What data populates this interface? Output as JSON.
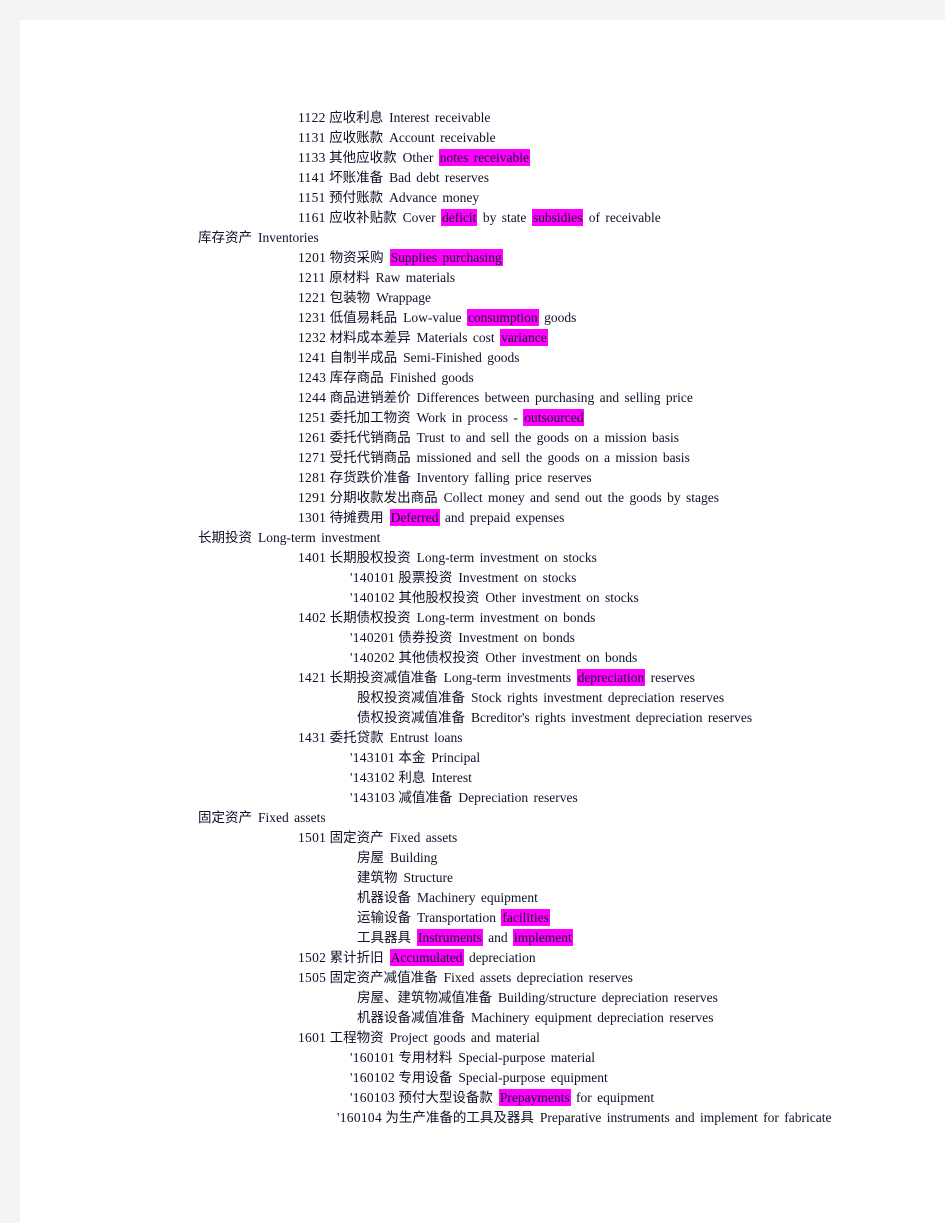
{
  "document": {
    "title": "Chinese-English Accounting Subjects (Assets)",
    "highlight_color": "#ff00ff",
    "text_color": "#101028",
    "page_background": "#ffffff",
    "canvas_background": "#f4f4f4"
  },
  "lines": [
    {
      "indent": "code",
      "code": "1122",
      "cn": "应收利息",
      "en": [
        {
          "t": "Interest receivable",
          "hl": false
        }
      ]
    },
    {
      "indent": "code",
      "code": "1131",
      "cn": "应收账款",
      "en": [
        {
          "t": "Account receivable",
          "hl": false
        }
      ]
    },
    {
      "indent": "code",
      "code": "1133",
      "cn": "其他应收款",
      "en": [
        {
          "t": "Other ",
          "hl": false
        },
        {
          "t": "notes receivable",
          "hl": true
        }
      ]
    },
    {
      "indent": "code",
      "code": "1141",
      "cn": "坏账准备",
      "en": [
        {
          "t": "Bad debt reserves",
          "hl": false
        }
      ]
    },
    {
      "indent": "code",
      "code": "1151",
      "cn": "预付账款",
      "en": [
        {
          "t": "Advance money",
          "hl": false
        }
      ]
    },
    {
      "indent": "code",
      "code": "1161",
      "cn": "应收补贴款",
      "en": [
        {
          "t": "Cover ",
          "hl": false
        },
        {
          "t": "deficit",
          "hl": true
        },
        {
          "t": " by state ",
          "hl": false
        },
        {
          "t": "subsidies",
          "hl": true
        },
        {
          "t": " of receivable",
          "hl": false
        }
      ]
    },
    {
      "indent": "head",
      "code": "",
      "cn": "库存资产",
      "en": [
        {
          "t": "Inventories",
          "hl": false
        }
      ]
    },
    {
      "indent": "code",
      "code": "1201",
      "cn": "物资采购",
      "en": [
        {
          "t": "Supplies purchasing",
          "hl": true
        }
      ]
    },
    {
      "indent": "code",
      "code": "1211",
      "cn": "原材料",
      "en": [
        {
          "t": "Raw materials",
          "hl": false
        }
      ]
    },
    {
      "indent": "code",
      "code": "1221",
      "cn": "包装物",
      "en": [
        {
          "t": "Wrappage",
          "hl": false
        }
      ]
    },
    {
      "indent": "code",
      "code": "1231",
      "cn": "低值易耗品",
      "en": [
        {
          "t": "Low-value ",
          "hl": false
        },
        {
          "t": "consumption",
          "hl": true
        },
        {
          "t": " goods",
          "hl": false
        }
      ]
    },
    {
      "indent": "code",
      "code": "1232",
      "cn": "材料成本差异",
      "en": [
        {
          "t": "Materials cost ",
          "hl": false
        },
        {
          "t": "variance",
          "hl": true
        }
      ]
    },
    {
      "indent": "code",
      "code": "1241",
      "cn": "自制半成品",
      "en": [
        {
          "t": "Semi-Finished goods",
          "hl": false
        }
      ]
    },
    {
      "indent": "code",
      "code": "1243",
      "cn": "库存商品",
      "en": [
        {
          "t": "Finished goods",
          "hl": false
        }
      ]
    },
    {
      "indent": "code",
      "code": "1244",
      "cn": "商品进销差价",
      "en": [
        {
          "t": "Differences between purchasing and selling price",
          "hl": false
        }
      ]
    },
    {
      "indent": "code",
      "code": "1251",
      "cn": "委托加工物资",
      "en": [
        {
          "t": "Work in process - ",
          "hl": false
        },
        {
          "t": "outsourced",
          "hl": true
        }
      ]
    },
    {
      "indent": "code",
      "code": "1261",
      "cn": "委托代销商品",
      "en": [
        {
          "t": "Trust to and sell the goods on a mission basis",
          "hl": false
        }
      ]
    },
    {
      "indent": "code",
      "code": "1271",
      "cn": "受托代销商品",
      "en": [
        {
          "t": "missioned and sell the goods on a mission basis",
          "hl": false
        }
      ]
    },
    {
      "indent": "code",
      "code": "1281",
      "cn": "存货跌价准备",
      "en": [
        {
          "t": "Inventory falling price reserves",
          "hl": false
        }
      ]
    },
    {
      "indent": "code",
      "code": "1291",
      "cn": "分期收款发出商品",
      "en": [
        {
          "t": "Collect money and send out the goods by stages",
          "hl": false
        }
      ]
    },
    {
      "indent": "code",
      "code": "1301",
      "cn": "待摊费用",
      "en": [
        {
          "t": "Deferred",
          "hl": true
        },
        {
          "t": " and prepaid expenses",
          "hl": false
        }
      ]
    },
    {
      "indent": "head",
      "code": "",
      "cn": "长期投资",
      "en": [
        {
          "t": "Long-term investment",
          "hl": false
        }
      ]
    },
    {
      "indent": "code",
      "code": "1401",
      "cn": "长期股权投资",
      "en": [
        {
          "t": "Long-term investment on stocks",
          "hl": false
        }
      ]
    },
    {
      "indent": "sub",
      "code": "'140101",
      "cn": "股票投资",
      "en": [
        {
          "t": "Investment on stocks",
          "hl": false
        }
      ]
    },
    {
      "indent": "sub",
      "code": "'140102",
      "cn": "其他股权投资",
      "en": [
        {
          "t": "Other investment on stocks",
          "hl": false
        }
      ]
    },
    {
      "indent": "code",
      "code": "1402",
      "cn": "长期债权投资",
      "en": [
        {
          "t": "Long-term investment on bonds",
          "hl": false
        }
      ]
    },
    {
      "indent": "sub",
      "code": "'140201",
      "cn": "债券投资",
      "en": [
        {
          "t": "Investment on bonds",
          "hl": false
        }
      ]
    },
    {
      "indent": "sub",
      "code": "'140202",
      "cn": "其他债权投资",
      "en": [
        {
          "t": "Other investment on bonds",
          "hl": false
        }
      ]
    },
    {
      "indent": "code",
      "code": "1421",
      "cn": "长期投资减值准备",
      "en": [
        {
          "t": "Long-term investments ",
          "hl": false
        },
        {
          "t": "depreciation",
          "hl": true
        },
        {
          "t": " reserves",
          "hl": false
        }
      ]
    },
    {
      "indent": "plain",
      "code": "",
      "cn": "股权投资减值准备",
      "en": [
        {
          "t": "Stock rights investment depreciation reserves",
          "hl": false
        }
      ]
    },
    {
      "indent": "plain",
      "code": "",
      "cn": "债权投资减值准备",
      "en": [
        {
          "t": "Bcreditor's rights investment depreciation reserves",
          "hl": false
        }
      ]
    },
    {
      "indent": "code",
      "code": "1431",
      "cn": "委托贷款",
      "en": [
        {
          "t": "Entrust loans",
          "hl": false
        }
      ]
    },
    {
      "indent": "sub",
      "code": "'143101",
      "cn": "本金",
      "en": [
        {
          "t": "Principal",
          "hl": false
        }
      ]
    },
    {
      "indent": "sub",
      "code": "'143102",
      "cn": "利息",
      "en": [
        {
          "t": "Interest",
          "hl": false
        }
      ]
    },
    {
      "indent": "sub",
      "code": "'143103",
      "cn": "减值准备",
      "en": [
        {
          "t": "Depreciation reserves",
          "hl": false
        }
      ]
    },
    {
      "indent": "head",
      "code": "",
      "cn": "固定资产",
      "en": [
        {
          "t": "Fixed assets",
          "hl": false
        }
      ]
    },
    {
      "indent": "code",
      "code": "1501",
      "cn": "固定资产",
      "en": [
        {
          "t": "Fixed assets",
          "hl": false
        }
      ]
    },
    {
      "indent": "plain",
      "code": "",
      "cn": "房屋",
      "en": [
        {
          "t": "Building",
          "hl": false
        }
      ]
    },
    {
      "indent": "plain",
      "code": "",
      "cn": "建筑物",
      "en": [
        {
          "t": "Structure",
          "hl": false
        }
      ]
    },
    {
      "indent": "plain",
      "code": "",
      "cn": "机器设备",
      "en": [
        {
          "t": "Machinery equipment",
          "hl": false
        }
      ]
    },
    {
      "indent": "plain",
      "code": "",
      "cn": "运输设备",
      "en": [
        {
          "t": "Transportation ",
          "hl": false
        },
        {
          "t": "facilities",
          "hl": true
        }
      ]
    },
    {
      "indent": "plain",
      "code": "",
      "cn": "工具器具",
      "en": [
        {
          "t": "Instruments",
          "hl": true
        },
        {
          "t": " and ",
          "hl": false
        },
        {
          "t": "implement",
          "hl": true
        }
      ]
    },
    {
      "indent": "code",
      "code": "1502",
      "cn": "累计折旧",
      "en": [
        {
          "t": "Accumulated",
          "hl": true
        },
        {
          "t": " depreciation",
          "hl": false
        }
      ]
    },
    {
      "indent": "code",
      "code": "1505",
      "cn": "固定资产减值准备",
      "en": [
        {
          "t": "Fixed assets depreciation reserves",
          "hl": false
        }
      ]
    },
    {
      "indent": "plain",
      "code": "",
      "cn": "房屋、建筑物减值准备",
      "en": [
        {
          "t": "Building/structure depreciation reserves",
          "hl": false
        }
      ]
    },
    {
      "indent": "plain",
      "code": "",
      "cn": "机器设备减值准备",
      "en": [
        {
          "t": "Machinery equipment depreciation reserves",
          "hl": false
        }
      ]
    },
    {
      "indent": "code",
      "code": "1601",
      "cn": "工程物资",
      "en": [
        {
          "t": "Project goods and material",
          "hl": false
        }
      ]
    },
    {
      "indent": "sub",
      "code": "'160101",
      "cn": "专用材料",
      "en": [
        {
          "t": "Special-purpose material",
          "hl": false
        }
      ]
    },
    {
      "indent": "sub",
      "code": "'160102",
      "cn": "专用设备",
      "en": [
        {
          "t": "Special-purpose equipment",
          "hl": false
        }
      ]
    },
    {
      "indent": "sub",
      "code": "'160103",
      "cn": "预付大型设备款",
      "en": [
        {
          "t": "Prepayments",
          "hl": true
        },
        {
          "t": " for equipment",
          "hl": false
        }
      ]
    },
    {
      "indent": "sub2",
      "code": "'160104",
      "cn": "为生产准备的工具及器具",
      "en": [
        {
          "t": "Preparative instruments and implement for fabricate",
          "hl": false
        }
      ]
    }
  ]
}
